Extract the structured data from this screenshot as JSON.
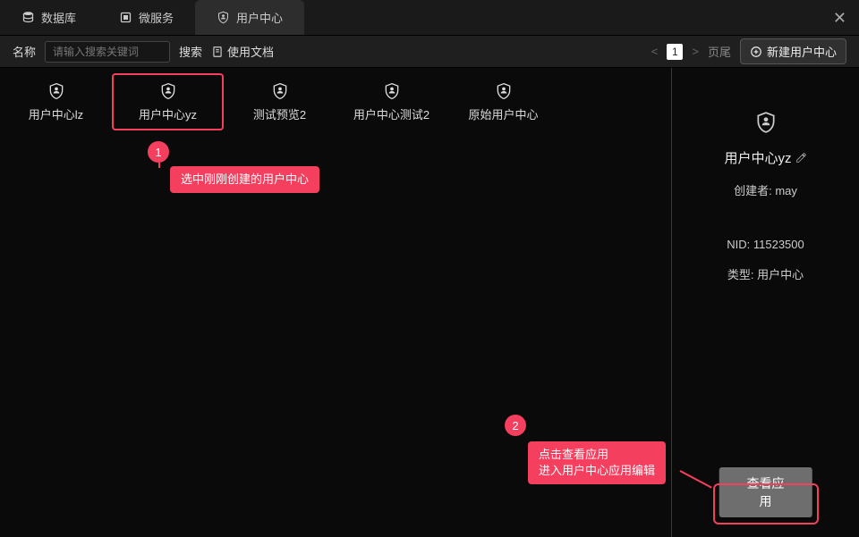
{
  "tabs": [
    {
      "label": "数据库",
      "icon": "database"
    },
    {
      "label": "微服务",
      "icon": "microservice"
    },
    {
      "label": "用户中心",
      "icon": "user-center",
      "active": true
    }
  ],
  "close_x": "✕",
  "toolbar": {
    "name_label": "名称",
    "search_placeholder": "请输入搜索关键词",
    "search_label": "搜索",
    "doc_label": "使用文档",
    "prev": "<",
    "page_num": "1",
    "next": ">",
    "page_tail": "页尾",
    "new_label": "新建用户中心"
  },
  "cards": [
    {
      "label": "用户中心lz"
    },
    {
      "label": "用户中心yz",
      "selected": true
    },
    {
      "label": "测试预览2"
    },
    {
      "label": "用户中心测试2"
    },
    {
      "label": "原始用户中心"
    }
  ],
  "detail": {
    "title": "用户中心yz",
    "creator": "创建者: may",
    "nid": "NID: 11523500",
    "type": "类型: 用户中心",
    "view_btn": "查看应用"
  },
  "annotations": {
    "step1_num": "1",
    "step1_text": "选中刚刚创建的用户中心",
    "step2_num": "2",
    "step2_text": "点击查看应用\n进入用户中心应用编辑"
  }
}
